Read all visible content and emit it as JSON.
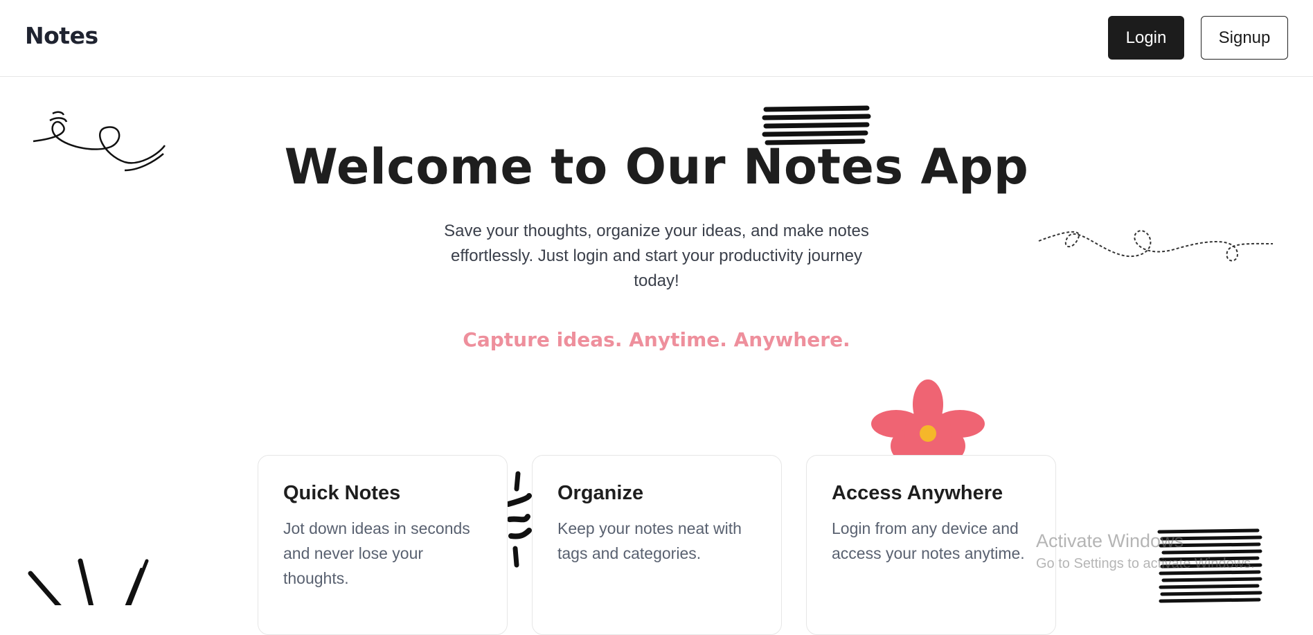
{
  "header": {
    "brand": "Notes",
    "login_label": "Login",
    "signup_label": "Signup"
  },
  "hero": {
    "title": "Welcome to Our Notes App",
    "subtitle": "Save your thoughts, organize your ideas, and make notes effortlessly. Just login and start your productivity journey today!",
    "tagline": "Capture ideas. Anytime. Anywhere."
  },
  "features": [
    {
      "title": "Quick Notes",
      "description": "Jot down ideas in seconds and never lose your thoughts."
    },
    {
      "title": "Organize",
      "description": "Keep your notes neat with tags and categories."
    },
    {
      "title": "Access Anywhere",
      "description": "Login from any device and access your notes anytime."
    }
  ],
  "watermark": {
    "line1": "Activate Windows",
    "line2": "Go to Settings to activate Windows."
  },
  "colors": {
    "accent_pink": "#ee8f9c",
    "flower_red": "#ef6473",
    "flower_center": "#f5b72a",
    "button_dark": "#1c1c1c"
  }
}
